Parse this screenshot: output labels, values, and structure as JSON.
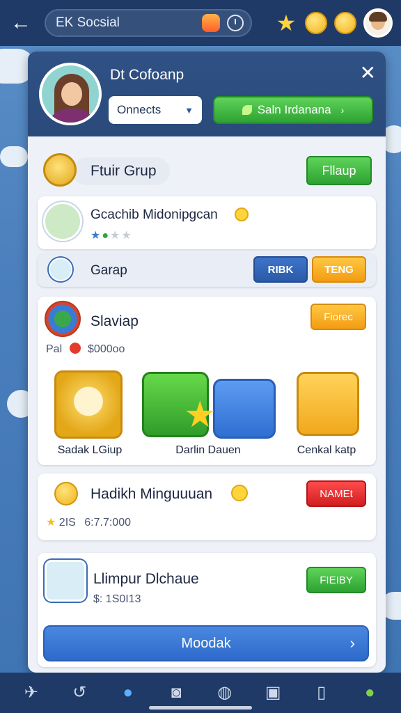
{
  "topbar": {
    "title": "EK Socsial"
  },
  "header": {
    "title": "Dt Cofoanp",
    "dropdown_value": "Onnects",
    "primary_button": "Saln Irdanana"
  },
  "section_group": {
    "title": "Ftuir Grup",
    "button": "Fllaup"
  },
  "member": {
    "name": "Gcachib Midonipgcan"
  },
  "garap_row": {
    "label": "Garap",
    "button_blue": "RIBK",
    "button_orange": "TENG"
  },
  "slaviap": {
    "title": "Slaviap",
    "button": "Fiorec",
    "price_prefix": "Pal",
    "price_value": "$000oo",
    "rewards": [
      {
        "label": "Sadak LGiup"
      },
      {
        "label": "Darlin Dauen"
      },
      {
        "label": "Cenkal katp"
      }
    ]
  },
  "hadikh": {
    "title": "Hadikh Minguuuan",
    "button": "NAMEt",
    "stat_count": "2IS",
    "stat_value": "6:7.7:000"
  },
  "llimpur": {
    "title": "Llimpur Dlchaue",
    "button": "FIEIBY",
    "value": "$: 1S0I13"
  },
  "action_button": "Moodak",
  "colors": {
    "topbar": "#1f3a66",
    "accent_green": "#2da232",
    "accent_blue": "#2e6acb",
    "accent_orange": "#f39c12",
    "accent_red": "#d11f1f"
  }
}
